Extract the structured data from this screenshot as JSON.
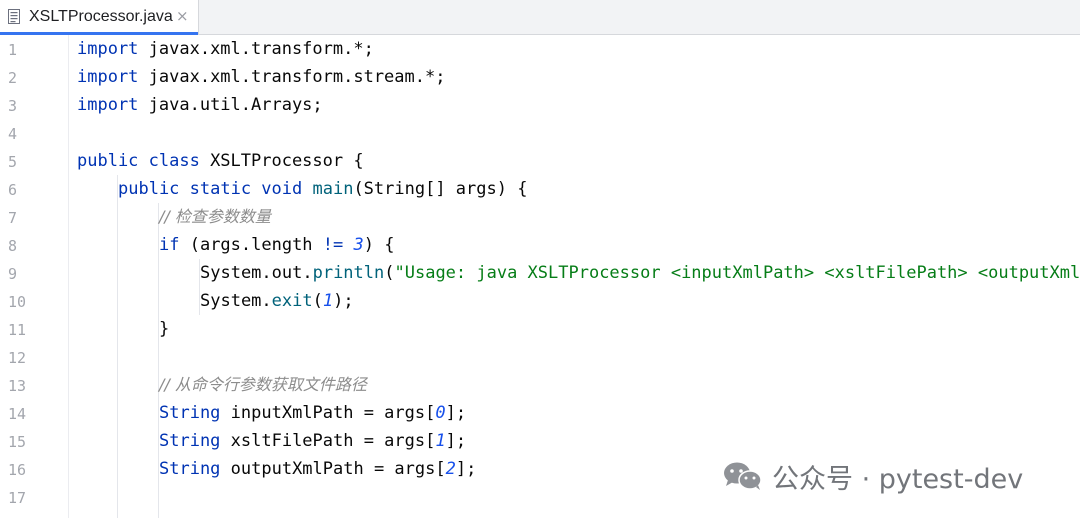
{
  "tab": {
    "label": "XSLTProcessor.java",
    "close_glyph": "×",
    "icon": "java-file-icon"
  },
  "line_numbers": [
    "1",
    "2",
    "3",
    "4",
    "5",
    "6",
    "7",
    "8",
    "9",
    "10",
    "11",
    "12",
    "13",
    "14",
    "15",
    "16",
    "17"
  ],
  "code": {
    "l1": {
      "kw": "import",
      "rest": " javax.xml.transform.*;"
    },
    "l2": {
      "kw": "import",
      "rest": " javax.xml.transform.stream.*;"
    },
    "l3": {
      "kw": "import",
      "rest": " java.util.Arrays;"
    },
    "l5": {
      "kw": "public class",
      "rest": " XSLTProcessor {"
    },
    "l6": {
      "kw": "public static void",
      "fn": "main",
      "rest": "(String[] args) {"
    },
    "l7": {
      "comment": "// 检查参数数量"
    },
    "l8": {
      "kw": "if",
      "pre": " (args.length ",
      "op": "!=",
      "sp": " ",
      "num": "3",
      "rest": ") {"
    },
    "l9": {
      "pre": "System.out.",
      "fn": "println",
      "paren": "(",
      "str": "\"Usage: java XSLTProcessor <inputXmlPath> <xsltFilePath> <outputXml"
    },
    "l10": {
      "pre": "System.",
      "fn": "exit",
      "open": "(",
      "num": "1",
      "rest": ");"
    },
    "l11": {
      "rest": "}"
    },
    "l13": {
      "comment": "// 从命令行参数获取文件路径"
    },
    "l14": {
      "type": "String",
      "rest": " inputXmlPath = args[",
      "num": "0",
      "end": "];"
    },
    "l15": {
      "type": "String",
      "rest": " xsltFilePath = args[",
      "num": "1",
      "end": "];"
    },
    "l16": {
      "type": "String",
      "rest": " outputXmlPath = args[",
      "num": "2",
      "end": "];"
    }
  },
  "watermark": {
    "text": "公众号 · pytest-dev",
    "icon": "wechat-icon"
  },
  "colors": {
    "keyword": "#0033b3",
    "function": "#00627a",
    "string": "#067d17",
    "number": "#1750eb",
    "comment": "#8c8c8c",
    "tab_accent": "#3574f0"
  }
}
